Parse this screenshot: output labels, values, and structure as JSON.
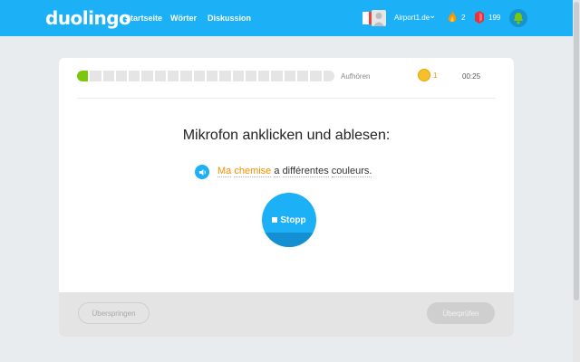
{
  "header": {
    "logo": "duolingo",
    "nav": [
      "Startseite",
      "Wörter",
      "Diskussion"
    ],
    "language_flag": "french-flag-icon",
    "username": "Airport1.de",
    "streak_count": "2",
    "gems_count": "199"
  },
  "lesson": {
    "progress_fraction": 0.05,
    "quit_label": "Aufhören",
    "coins": "1",
    "timer": "00:25",
    "prompt": "Mikrofon anklicken und ablesen:",
    "sentence_words": [
      "Ma",
      "chemise",
      "a",
      "différentes",
      "couleurs."
    ],
    "record_button_label": "Stopp"
  },
  "footer": {
    "skip_label": "Überspringen",
    "check_label": "Überprüfen"
  },
  "colors": {
    "brand": "#1cb0f6",
    "progress_done": "#7ac70c",
    "highlight": "#f49000"
  }
}
